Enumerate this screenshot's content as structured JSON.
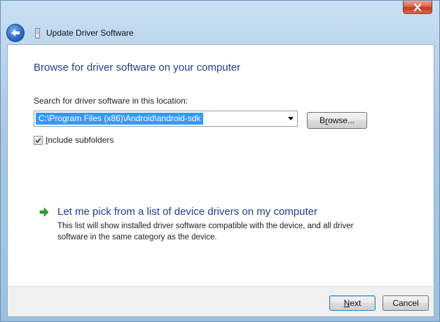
{
  "window": {
    "title": "Update Driver Software",
    "close_icon": "close-icon",
    "back_icon": "back-arrow-icon",
    "device_icon": "device-icon"
  },
  "content": {
    "heading": "Browse for driver software on your computer",
    "search_label": "Search for driver software in this location:",
    "path_value": "C:\\Program Files (x86)\\Android\\android-sdk",
    "browse_label_pre": "B",
    "browse_label_u": "r",
    "browse_label_post": "owse...",
    "include_subfolders": {
      "label_u": "I",
      "label_rest": "nclude subfolders",
      "checked": true
    },
    "pick": {
      "icon": "green-arrow-icon",
      "title": "Let me pick from a list of device drivers on my computer",
      "desc_line1": "This list will show installed driver software compatible with the device, and all driver",
      "desc_line2": "software in the same category as the device."
    }
  },
  "footer": {
    "next_u": "N",
    "next_rest": "ext",
    "cancel": "Cancel"
  },
  "colors": {
    "heading": "#1f3f8c",
    "selection": "#3399ff",
    "green_arrow": "#2e9e2a"
  }
}
